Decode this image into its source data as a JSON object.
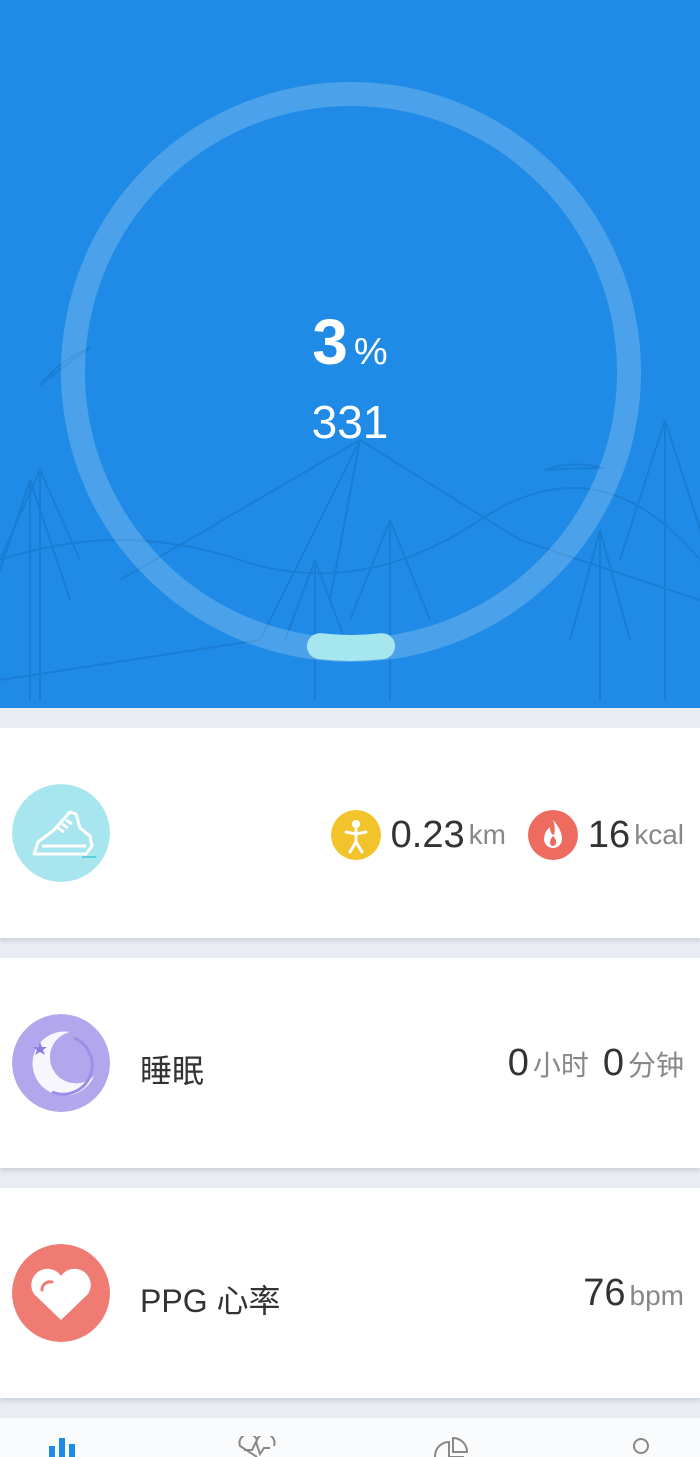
{
  "activity": {
    "percent": "3",
    "percent_unit": "%",
    "steps": "331",
    "progress_fraction": 0.03
  },
  "running": {
    "distance_value": "0.23",
    "distance_unit": "km",
    "calories_value": "16",
    "calories_unit": "kcal"
  },
  "sleep": {
    "label": "睡眠",
    "hours_value": "0",
    "hours_unit": "小时",
    "minutes_value": "0",
    "minutes_unit": "分钟"
  },
  "heart": {
    "label": "PPG 心率",
    "bpm_value": "76",
    "bpm_unit": "bpm"
  },
  "colors": {
    "hero": "#1f8be6",
    "progress": "#a6e6ee",
    "running": "#a7e6ee",
    "sleep": "#b2a7ec",
    "heart": "#f07b72",
    "distance": "#f2c32b",
    "calories": "#ee6b60"
  },
  "tabs": [
    {
      "icon": "bar-chart-icon"
    },
    {
      "icon": "heartbeat-icon"
    },
    {
      "icon": "pie-chart-icon"
    },
    {
      "icon": "profile-icon"
    }
  ]
}
